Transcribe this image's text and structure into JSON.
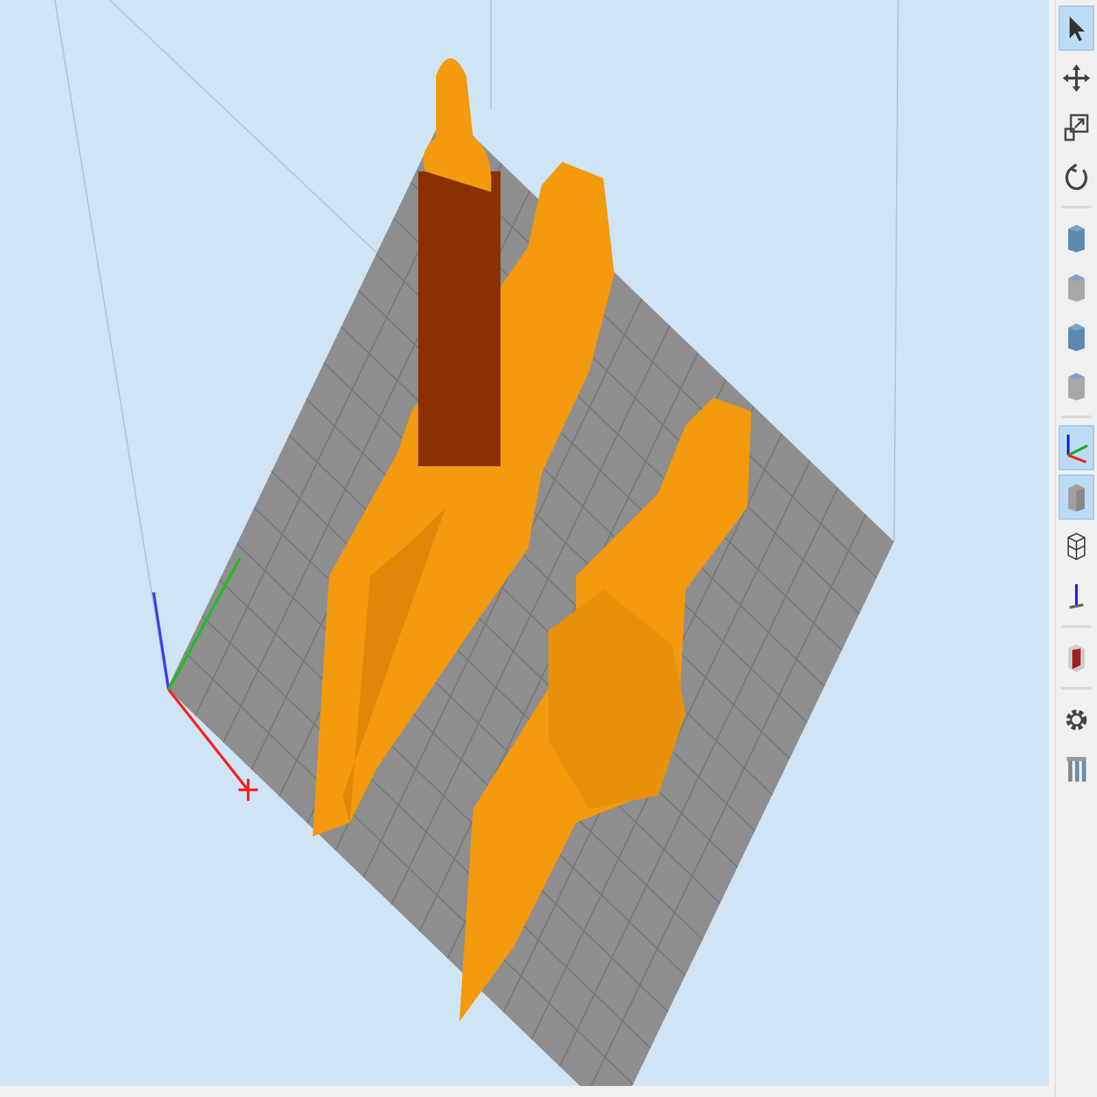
{
  "toolbar": {
    "groups": [
      {
        "items": [
          {
            "kind": "select",
            "selected": true
          },
          {
            "kind": "move",
            "selected": false
          },
          {
            "kind": "scale",
            "selected": false
          },
          {
            "kind": "rotate",
            "selected": false
          }
        ]
      },
      {
        "items": [
          {
            "kind": "view-top",
            "selected": false
          },
          {
            "kind": "view-front",
            "selected": false
          },
          {
            "kind": "view-side",
            "selected": false
          },
          {
            "kind": "view-right",
            "selected": false
          }
        ]
      },
      {
        "items": [
          {
            "kind": "axes",
            "selected": true
          },
          {
            "kind": "solid",
            "selected": true
          },
          {
            "kind": "wireframe",
            "selected": false
          },
          {
            "kind": "zaxis",
            "selected": false
          }
        ]
      },
      {
        "items": [
          {
            "kind": "cut",
            "selected": false
          }
        ]
      },
      {
        "items": [
          {
            "kind": "gear",
            "selected": false
          },
          {
            "kind": "supports",
            "selected": false
          }
        ]
      }
    ]
  }
}
